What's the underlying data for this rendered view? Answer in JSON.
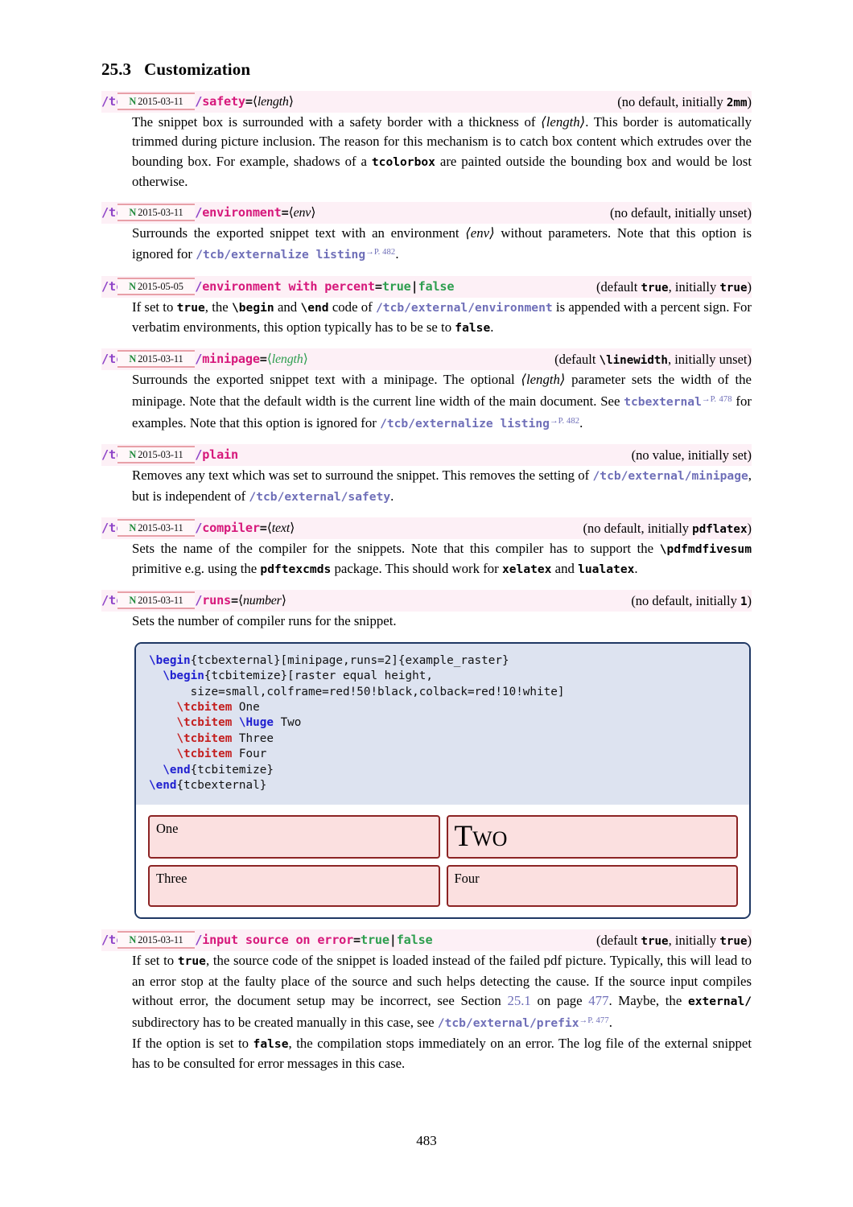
{
  "heading": {
    "number": "25.3",
    "title": "Customization"
  },
  "colors": {
    "path_prefix": "#8e44c8",
    "key_name": "#d6187b",
    "value_green": "#2e9e4f",
    "reference_blue": "#6f6fb8",
    "highlight_bg": "#fdf0f6",
    "badge_rule": "#e8a0a8",
    "badge_new": "#1f8a3b",
    "box_frame": "#1f3864",
    "code_bg": "#dde3f0",
    "raster_frame": "#8c2424",
    "raster_bg": "#fbe0e0"
  },
  "entries": [
    {
      "badge_new": "N",
      "badge_date": "2015-03-11",
      "path_prefix": "/tcb/external/",
      "key_name": "safety",
      "equals": "=",
      "argument": "length",
      "default_note": "(no default, initially 2mm)",
      "default_mono": "2mm",
      "description": "The snippet box is surrounded with a safety border with a thickness of ⟨length⟩. This border is automatically trimmed during picture inclusion. The reason for this mechanism is to catch box content which extrudes over the bounding box. For example, shadows of a tcolorbox are painted outside the bounding box and would be lost otherwise."
    },
    {
      "badge_new": "N",
      "badge_date": "2015-03-11",
      "path_prefix": "/tcb/external/",
      "key_name": "environment",
      "equals": "=",
      "argument": "env",
      "default_note": "(no default, initially unset)",
      "description": "Surrounds the exported snippet text with an environment ⟨env⟩ without parameters. Note that this option is ignored for /tcb/externalize listing→P.482.",
      "reference": "/tcb/externalize listing",
      "reference_page": "P. 482"
    },
    {
      "badge_new": "N",
      "badge_date": "2015-05-05",
      "path_prefix": "/tcb/external/",
      "key_name": "environment with percent",
      "equals": "=",
      "value_true": "true",
      "value_sep": "|",
      "value_false": "false",
      "default_note": "(default true, initially true)",
      "description": "If set to true, the \\begin and \\end code of /tcb/external/environment is appended with a percent sign. For verbatim environments, this option typically has to be se to false."
    },
    {
      "badge_new": "N",
      "badge_date": "2015-03-11",
      "path_prefix": "/tcb/external/",
      "key_name": "minipage",
      "equals": "=",
      "argument": "length",
      "default_note": "(default \\linewidth, initially unset)",
      "default_mono": "\\linewidth",
      "description": "Surrounds the exported snippet text with a minipage. The optional ⟨length⟩ parameter sets the width of the minipage. Note that the default width is the current line width of the main document. See tcbexternal→P.478 for examples. Note that this option is ignored for /tcb/externalize listing→P.482.",
      "reference_1": "tcbexternal",
      "reference_1_page": "P. 478",
      "reference_2": "/tcb/externalize listing",
      "reference_2_page": "P. 482"
    },
    {
      "badge_new": "N",
      "badge_date": "2015-03-11",
      "path_prefix": "/tcb/external/",
      "key_name": "plain",
      "default_note": "(no value, initially set)",
      "description": "Removes any text which was set to surround the snippet. This removes the setting of /tcb/external/minipage, but is independent of /tcb/external/safety.",
      "reference_1": "/tcb/external/minipage",
      "reference_2": "/tcb/external/safety"
    },
    {
      "badge_new": "N",
      "badge_date": "2015-03-11",
      "path_prefix": "/tcb/external/",
      "key_name": "compiler",
      "equals": "=",
      "argument": "text",
      "default_note": "(no default, initially pdflatex)",
      "default_mono": "pdflatex",
      "description": "Sets the name of the compiler for the snippets. Note that this compiler has to support the \\pdfmdfivesum primitive e.g. using the pdftexcmds package. This should work for xelatex and lualatex."
    },
    {
      "badge_new": "N",
      "badge_date": "2015-03-11",
      "path_prefix": "/tcb/external/",
      "key_name": "runs",
      "equals": "=",
      "argument": "number",
      "default_note": "(no default, initially 1)",
      "default_mono": "1",
      "description": "Sets the number of compiler runs for the snippet."
    },
    {
      "badge_new": "N",
      "badge_date": "2015-03-11",
      "path_prefix": "/tcb/external/",
      "key_name": "input source on error",
      "equals": "=",
      "value_true": "true",
      "value_sep": "|",
      "value_false": "false",
      "default_note": "(default true, initially true)",
      "description": "If set to true, the source code of the snippet is loaded instead of the failed pdf picture. Typically, this will lead to an error stop at the faulty place of the source and such helps detecting the cause. If the source input compiles without error, the document setup may be incorrect, see Section 25.1 on page 477. Maybe, the external/ subdirectory has to be created manually in this case, see /tcb/external/prefix→P.477.",
      "description_2": "If the option is set to false, the compilation stops immediately on an error. The log file of the external snippet has to be consulted for error messages in this case."
    }
  ],
  "example": {
    "code_lines": [
      "\\begin{tcbexternal}[minipage,runs=2]{example_raster}",
      "  \\begin{tcbitemize}[raster equal height,",
      "      size=small,colframe=red!50!black,colback=red!10!white]",
      "    \\tcbitem One",
      "    \\tcbitem \\Huge Two",
      "    \\tcbitem Three",
      "    \\tcbitem Four",
      "  \\end{tcbitemize}",
      "\\end{tcbexternal}"
    ],
    "code_tokens": {
      "begin": "\\begin",
      "end": "\\end",
      "tcbitem": "\\tcbitem",
      "huge": "\\Huge"
    },
    "raster_items": [
      {
        "label": "One",
        "style": "small"
      },
      {
        "label": "Two",
        "style": "huge"
      },
      {
        "label": "Three",
        "style": "small"
      },
      {
        "label": "Four",
        "style": "small"
      }
    ]
  },
  "footer": {
    "page_number": "483"
  }
}
